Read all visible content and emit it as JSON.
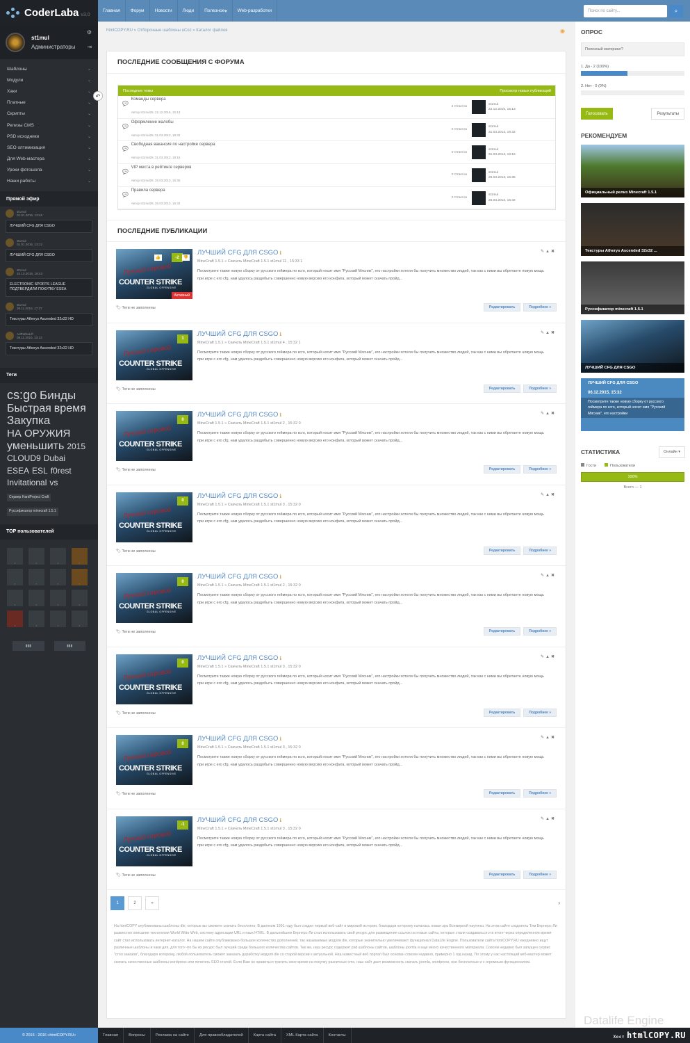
{
  "logo": {
    "name": "CoderLaba",
    "version": "v3.0"
  },
  "user": {
    "name": "st1mul",
    "role": "Администраторы"
  },
  "menu": [
    "Шаблоны",
    "Модули",
    "Хаки",
    "Платные",
    "Скрипты",
    "Релизы CMS",
    "PSD исходники",
    "SEO оптимизация",
    "Для Web-мастера",
    "Уроки фотошопа",
    "Наши работы"
  ],
  "live": {
    "title": "Прямой эфир",
    "items": [
      {
        "user": "st1mul",
        "date": "01.01.2016, 13:45",
        "text": "ЛУЧШИЙ CFG ДЛЯ CSGO"
      },
      {
        "user": "st1mul",
        "date": "01.01.2016, 13:12",
        "text": "ЛУЧШИЙ CFG ДЛЯ CSGO"
      },
      {
        "user": "st1mul",
        "date": "10.12.2015, 18:43",
        "text": "ELECTRONIC SPORTS LEAGUE ПОДТВЕРДИЛИ ПОКУПКУ ESEA"
      },
      {
        "user": "st1mul",
        "date": "28.11.2015, 17:37",
        "text": "Текстуры Atherys Ascended 32x32 HD"
      },
      {
        "user": "AdPathaLift",
        "date": "05.11.2015, 23:13",
        "text": "Текстуры Atherys Ascended 32x32 HD"
      }
    ]
  },
  "tags": {
    "title": "Теги",
    "items": [
      {
        "t": "cs:go",
        "s": 18
      },
      {
        "t": "Бинды",
        "s": 17
      },
      {
        "t": "Быстрая",
        "s": 16
      },
      {
        "t": "время",
        "s": 16
      },
      {
        "t": "Закупка",
        "s": 17
      },
      {
        "t": "НА ОРУЖИЯ",
        "s": 15
      },
      {
        "t": "уменьшить",
        "s": 16
      },
      {
        "t": "2015",
        "s": 12
      },
      {
        "t": "CLOUD9",
        "s": 12
      },
      {
        "t": "Dubai",
        "s": 12
      },
      {
        "t": "ESEA",
        "s": 12
      },
      {
        "t": "ESL",
        "s": 12
      },
      {
        "t": "f0rest",
        "s": 12
      },
      {
        "t": "Invitational",
        "s": 12
      },
      {
        "t": "vs",
        "s": 12
      },
      {
        "t": "Сервер HardProject Craft",
        "s": 5
      },
      {
        "t": "Руссификатор minecraft 1.5.1",
        "s": 5
      }
    ]
  },
  "top_users": {
    "title": "TOP пользователей"
  },
  "nav": [
    "Главная",
    "Форум",
    "Новости",
    "Люди",
    "Полезное",
    "Web-разработки"
  ],
  "search": {
    "placeholder": "Поиск по сайту..."
  },
  "breadcrumb": "htmlCOPY.RU » Отборочные шаблоны uCoz » Каталог файлов",
  "forum": {
    "title": "ПОСЛЕДНИЕ СООБЩЕНИЯ С ФОРУМА",
    "header_left": "Последние темы",
    "header_right": "Просмотр новых публикаций",
    "rows": [
      {
        "topic": "Команды сервера",
        "author": "Автор st1mul29, 22.12.2015, 15:13",
        "answers": "2 Ответов",
        "last_user": "st1mul",
        "last_date": "22.12.2015, 15:13"
      },
      {
        "topic": "Оформление жалобы",
        "author": "Автор st1mul29, 31.03.2013, 18:32",
        "answers": "0 Ответов",
        "last_user": "st1mul",
        "last_date": "31.03.2013, 18:32"
      },
      {
        "topic": "Свободная вакансия по настройке сервера",
        "author": "Автор st1mul29, 31.03.2013, 18:16",
        "answers": "0 Ответов",
        "last_user": "st1mul",
        "last_date": "31.03.2013, 18:16"
      },
      {
        "topic": "VIP места в рейтинге серверов",
        "author": "Автор st1mul29, 25.03.2013, 15:36",
        "answers": "0 Ответов",
        "last_user": "st1mul",
        "last_date": "25.03.2013, 15:36"
      },
      {
        "topic": "Правила сервера",
        "author": "Автор st1mul29, 25.03.2013, 15:32",
        "answers": "0 Ответов",
        "last_user": "st1mul",
        "last_date": "25.03.2013, 15:32"
      }
    ]
  },
  "pubs": {
    "title": "ПОСЛЕДНИЕ ПУБЛИКАЦИИ",
    "items": [
      {
        "title": "ЛУЧШИЙ CFG ДЛЯ CSGO",
        "rating": "-2",
        "meta": "MineCraft 1.5.1 » Скачать MineCraft 1.5.1   st1mul   11   , 15:33   1",
        "active": "Активный"
      },
      {
        "title": "ЛУЧШИЙ CFG ДЛЯ CSGO",
        "rating": "1",
        "meta": "MineCraft 1.5.1 » Скачать MineCraft 1.5.1   st1mul   4   , 15:32   1"
      },
      {
        "title": "ЛУЧШИЙ CFG ДЛЯ CSGO",
        "rating": "0",
        "meta": "MineCraft 1.5.1 » Скачать MineCraft 1.5.1   st1mul   2   , 15:32   0"
      },
      {
        "title": "ЛУЧШИЙ CFG ДЛЯ CSGO",
        "rating": "0",
        "meta": "MineCraft 1.5.1 » Скачать MineCraft 1.5.1   st1mul   3   , 15:32   0"
      },
      {
        "title": "ЛУЧШИЙ CFG ДЛЯ CSGO",
        "rating": "0",
        "meta": "MineCraft 1.5.1 » Скачать MineCraft 1.5.1   st1mul   2   , 15:32   0"
      },
      {
        "title": "ЛУЧШИЙ CFG ДЛЯ CSGO",
        "rating": "0",
        "meta": "MineCraft 1.5.1 » Скачать MineCraft 1.5.1   st1mul   3   , 15:32   0"
      },
      {
        "title": "ЛУЧШИЙ CFG ДЛЯ CSGO",
        "rating": "0",
        "meta": "MineCraft 1.5.1 » Скачать MineCraft 1.5.1   st1mul   3   , 15:32   0"
      },
      {
        "title": "ЛУЧШИЙ CFG ДЛЯ CSGO",
        "rating": "-1",
        "meta": "MineCraft 1.5.1 » Скачать MineCraft 1.5.1   st1mul   3   , 15:32   0"
      }
    ],
    "desc": "Посмотрите также новую сборку от русского геймера по ксго, который носит имя \"Русский Мясник\", его настройки хотели бы получить множество людей, так как с ними вы обретаете новую мощь при игре с его cfg, нам удалось раздобыть совершенно новую версию его конфига, который может скачать пройд...",
    "tags_label": "Теги не заполнены",
    "edit": "Редактировать",
    "more": "Подробнее »"
  },
  "pager": [
    "1",
    "2",
    "»"
  ],
  "seo": "На htmlCOPY опубликованы шаблоны dle, которые вы сможете скачать бесплатно. В далеком 1991 году был создан первый веб-сайт в мировой истории, благодаря которому началась новая эра Всемирной паутины. На этом сайте создатель Тим Бернерс-Ли разместил описание технологии World Wide Web, систему адресации URL и язык HTML. В дальнейшем Бернерс-Ли стал использовать свой ресурс для размещения ссылок на новые сайты, которые стали создаваться и в итоге через определенное время сайт стал использовать интернет-каталог. На нашем сайте опубликовано большое количество дополнений, так называемые модули dle, которые значительно увеличивают функционал DataLife Engine. Пользователи сайта htmlCOPY.RU ежедневно ищут различные шаблоны и хаки для, для того что бы их ресурс был лучший среди большого количества сайтов. Так же, наш ресурс содержит psd шаблоны сайтов, шаблоны joomla и еще много качественного материала. Совсем недавно был запущен сервис \"стол заказов\", благодаря которому, любой пользователь сможет заказать доработку модуля dle со старой версии к актуальной. Наш известный веб портал был основан совсем недавно, примерно 1 год назад. По этому у нас настоящий веб-мастер может скачать качественные шаблоны wordpress или почитать SEO-статей. Если Вам не нравиться тратить свое время на покупку различных cms, наш сайт дает возможность скачать joomla, wordpress, они бесплатные и с огромным функционалом.",
  "poll": {
    "title": "ОПРОС",
    "question": "Полезный материал?",
    "options": [
      {
        "label": "1. Да - 2 (100%)",
        "pct": 100
      },
      {
        "label": "2. Нет - 0 (0%)",
        "pct": 0
      }
    ],
    "vote": "Голосовать",
    "results": "Результаты"
  },
  "recommend": {
    "title": "РЕКОМЕНДУЕМ",
    "items": [
      "Официальный релиз Minecraft 1.5.1",
      "Текстуры Atherys Ascended 32x32 ...",
      "Руссификатор minecraft 1.5.1",
      "ЛУЧШИЙ CFG ДЛЯ CSGO"
    ],
    "last": {
      "title": "ЛУЧШИЙ CFG ДЛЯ CSGO",
      "date": "06.12.2015, 15:32",
      "text": "Посмотрите также новую сборку от русского геймера по ксго, который носит имя \"Русский Мясник\", его настройки"
    }
  },
  "stats": {
    "title": "СТАТИСТИКА",
    "dropdown": "Онлайн",
    "guests": "Гости",
    "users": "Пользователи",
    "bar": "100%",
    "total": "Всего — 1"
  },
  "dle": "Datalife Engine",
  "footer": {
    "copyright": "© 2015 - 2016 «htmlCOPY.RU»",
    "links": [
      "Главная",
      "Вопросы",
      "Реклама на сайте",
      "Для правообладателей",
      "Карта сайта",
      "XML Карта сайта",
      "Контакты"
    ],
    "host": "Хост",
    "watermark": "htmlCOPY.RU"
  }
}
